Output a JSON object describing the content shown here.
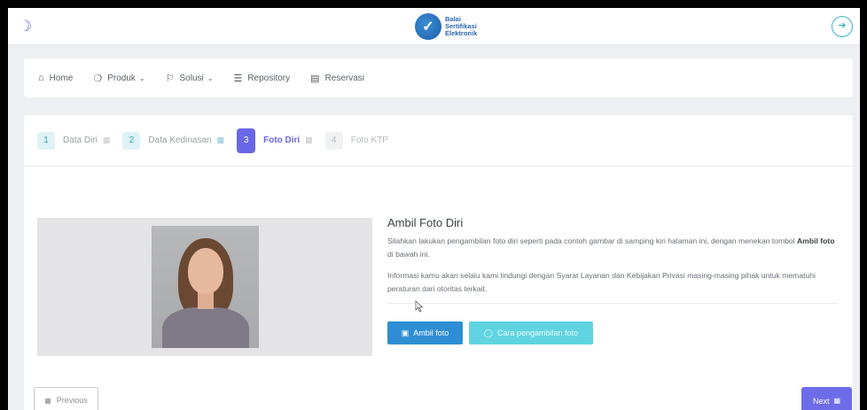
{
  "topbar": {
    "theme_icon": "moon-icon",
    "logo_text_1": "Balai",
    "logo_text_2": "Sertifikasi",
    "logo_text_3": "Elektronik",
    "logout_icon": "sign-in-icon"
  },
  "nav": {
    "items": [
      {
        "label": "Home",
        "icon": "home-icon"
      },
      {
        "label": "Produk",
        "icon": "box-icon"
      },
      {
        "label": "Solusi",
        "icon": "flag-icon"
      },
      {
        "label": "Repository",
        "icon": "layers-icon"
      },
      {
        "label": "Reservasi",
        "icon": "calendar-icon"
      }
    ]
  },
  "stepper": {
    "steps": [
      {
        "num": "1",
        "label": "Data Diri",
        "state": "done"
      },
      {
        "num": "2",
        "label": "Data Kedinasan",
        "state": "done"
      },
      {
        "num": "3",
        "label": "Foto Diri",
        "state": "active"
      },
      {
        "num": "4",
        "label": "Foto KTP",
        "state": "todo"
      }
    ]
  },
  "content": {
    "title": "Ambil Foto Diri",
    "para1_a": "Silahkan lakukan pengambilan foto diri seperti pada contoh gambar di samping kiri halaman ini, dengan menekan tombol ",
    "para1_b": "Ambil foto",
    "para1_c": " di bawah ini.",
    "para2": "Informasi kamu akan selalu kami lindungi dengan Syarat Layanan dan Kebijakan Privasi masing-masing pihak untuk mematuhi peraturan dari otoritas terkait.",
    "take_photo_label": "Ambil foto",
    "how_to_label": "Cara pengambilan foto"
  },
  "footer": {
    "previous_label": "Previous",
    "next_label": "Next"
  },
  "colors": {
    "accent": "#6a67e6",
    "primary": "#2f8ed3",
    "info": "#5fd4e0"
  }
}
